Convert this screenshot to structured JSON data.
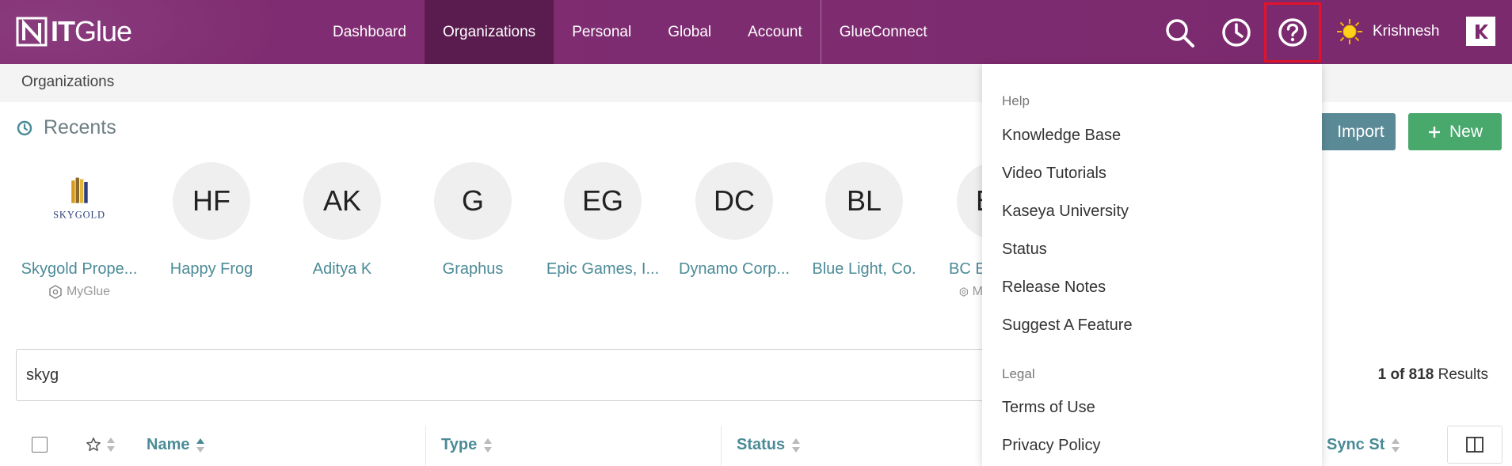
{
  "app": {
    "brand_bold": "IT",
    "brand_light": "Glue"
  },
  "nav": {
    "items": [
      {
        "label": "Dashboard",
        "active": false
      },
      {
        "label": "Organizations",
        "active": true
      },
      {
        "label": "Personal",
        "active": false
      },
      {
        "label": "Global",
        "active": false
      },
      {
        "label": "Account",
        "active": false
      },
      {
        "label": "GlueConnect",
        "active": false
      }
    ]
  },
  "header": {
    "user_name": "Krishnesh",
    "icons": [
      "search-icon",
      "history-clock-icon",
      "help-question-icon"
    ]
  },
  "breadcrumb": "Organizations",
  "recents": {
    "title": "Recents",
    "items": [
      {
        "initials": "",
        "logo_text": "SKYGOLD",
        "name": "Skygold Prope...",
        "sub": "MyGlue"
      },
      {
        "initials": "HF",
        "name": "Happy Frog",
        "sub": ""
      },
      {
        "initials": "AK",
        "name": "Aditya K",
        "sub": ""
      },
      {
        "initials": "G",
        "name": "Graphus",
        "sub": ""
      },
      {
        "initials": "EG",
        "name": "Epic Games, I...",
        "sub": ""
      },
      {
        "initials": "DC",
        "name": "Dynamo Corp...",
        "sub": ""
      },
      {
        "initials": "BL",
        "name": "Blue Light, Co.",
        "sub": ""
      },
      {
        "initials": "B",
        "name": "BC E",
        "sub": "M"
      }
    ]
  },
  "buttons": {
    "import": "Import",
    "new": "New"
  },
  "search": {
    "value": "skyg",
    "results_count": "1 of 818",
    "results_label": "Results"
  },
  "table": {
    "columns": [
      "Name",
      "Type",
      "Status",
      "Sync St"
    ]
  },
  "help_menu": {
    "section_help": "Help",
    "help_items": [
      "Knowledge Base",
      "Video Tutorials",
      "Kaseya University",
      "Status",
      "Release Notes",
      "Suggest A Feature"
    ],
    "section_legal": "Legal",
    "legal_items": [
      "Terms of Use",
      "Privacy Policy"
    ]
  },
  "colors": {
    "topbar": "#7d2a6f",
    "nav_active": "#5a1c4f",
    "link_teal": "#4b8b97",
    "import_btn": "#5a8a96",
    "new_btn": "#49a86c",
    "highlight_border": "#e0142b"
  }
}
